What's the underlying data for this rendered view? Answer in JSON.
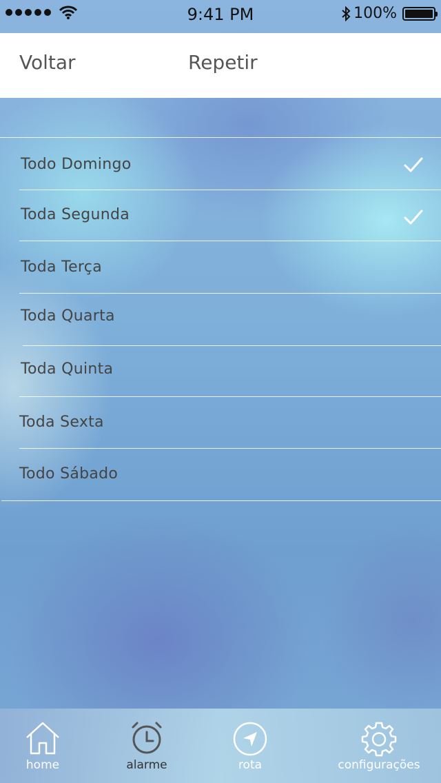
{
  "status_bar": {
    "time": "9:41 PM",
    "battery": "100%",
    "signal_icon": "signal-dots-icon",
    "wifi_icon": "wifi-icon",
    "bluetooth_icon": "bluetooth-icon"
  },
  "nav": {
    "back_label": "Voltar",
    "title": "Repetir"
  },
  "repeat_days": [
    {
      "label": "Todo Domingo",
      "checked": true
    },
    {
      "label": "Toda Segunda",
      "checked": true
    },
    {
      "label": "Toda Terça",
      "checked": false
    },
    {
      "label": "Toda Quarta",
      "checked": false
    },
    {
      "label": "Toda Quinta",
      "checked": false
    },
    {
      "label": "Toda Sexta",
      "checked": false
    },
    {
      "label": "Todo Sábado",
      "checked": false
    }
  ],
  "tab_bar": {
    "tabs": [
      {
        "label": "home",
        "icon": "home-icon"
      },
      {
        "label": "alarme",
        "icon": "alarm-clock-icon",
        "active": true
      },
      {
        "label": "rota",
        "icon": "navigation-arrow-icon"
      },
      {
        "label": "configurações",
        "icon": "gear-icon"
      }
    ]
  },
  "colors": {
    "nav_background": "#ffffff",
    "text": "#444444",
    "separator": "#ffffff"
  }
}
